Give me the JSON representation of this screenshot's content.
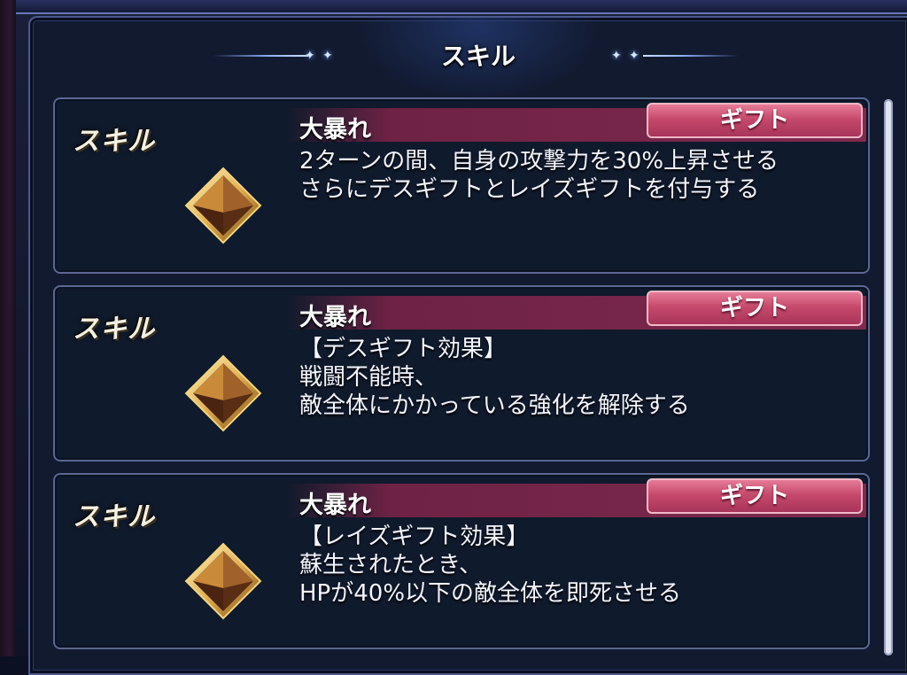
{
  "header": {
    "title": "スキル"
  },
  "cards": [
    {
      "label": "スキル",
      "name": "大暴れ",
      "badge": "ギフト",
      "description": [
        "2ターンの間、自身の攻撃力を30%上昇させる",
        "さらにデスギフトとレイズギフトを付与する"
      ]
    },
    {
      "label": "スキル",
      "name": "大暴れ",
      "badge": "ギフト",
      "description": [
        "【デスギフト効果】",
        "戦闘不能時、",
        "敵全体にかかっている強化を解除する"
      ]
    },
    {
      "label": "スキル",
      "name": "大暴れ",
      "badge": "ギフト",
      "description": [
        "【レイズギフト効果】",
        "蘇生されたとき、",
        "HPが40%以下の敵全体を即死させる"
      ]
    }
  ],
  "icons": {
    "skill": "gold-diamond-gem-icon",
    "decor": "sparkle-star-icon"
  },
  "colors": {
    "panel_bg": "#121a30",
    "name_band": "#7e2a4e",
    "gift_badge": "#c64a6c",
    "text": "#ffffff"
  }
}
